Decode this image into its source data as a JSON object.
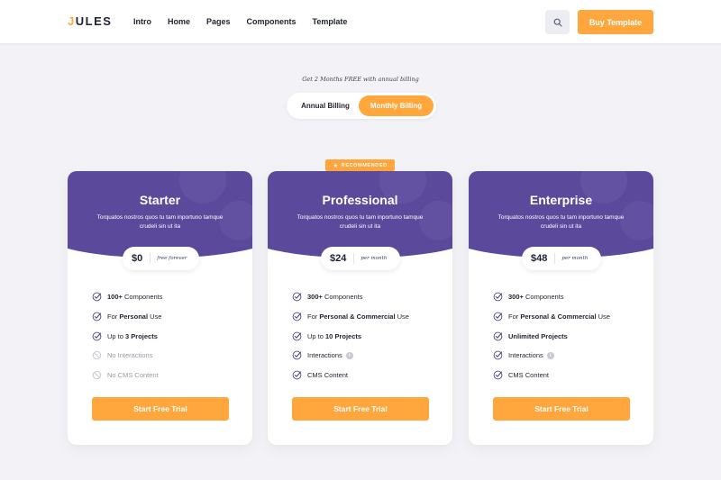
{
  "header": {
    "logo_prefix": "J",
    "logo_rest": "ULES",
    "nav": [
      "Intro",
      "Home",
      "Pages",
      "Components",
      "Template"
    ],
    "search_icon": "search-icon",
    "buy_label": "Buy Template"
  },
  "billing": {
    "promo": "Get 2 Months FREE with annual billing",
    "options": [
      "Annual Billing",
      "Monthly Billing"
    ],
    "selected": "Monthly Billing"
  },
  "colors": {
    "accent": "#ffa63d",
    "header_purple": "#5b4a9b",
    "text": "#1f2231"
  },
  "recommended": "RECOMMENDED",
  "plans": [
    {
      "name": "Starter",
      "desc": "Torquatos nostros quos tu tam inportuno tamque crudeli sin ut ita",
      "price": "$0",
      "period": "free forever",
      "features": [
        {
          "pre": "",
          "bold": "100+",
          "post": " Components",
          "enabled": true,
          "info": false
        },
        {
          "pre": "For ",
          "bold": "Personal",
          "post": " Use",
          "enabled": true,
          "info": false
        },
        {
          "pre": "Up to ",
          "bold": "3 Projects",
          "post": "",
          "enabled": true,
          "info": false
        },
        {
          "pre": "No Interactions",
          "bold": "",
          "post": "",
          "enabled": false,
          "info": false
        },
        {
          "pre": "No CMS Content",
          "bold": "",
          "post": "",
          "enabled": false,
          "info": false
        }
      ],
      "cta": "Start Free Trial"
    },
    {
      "name": "Professional",
      "desc": "Torquatos nostros quos tu tam inportuno tamque crudeli sin ut ita",
      "price": "$24",
      "period": "per month",
      "features": [
        {
          "pre": "",
          "bold": "300+",
          "post": " Components",
          "enabled": true,
          "info": false
        },
        {
          "pre": "For ",
          "bold": "Personal & Commercial",
          "post": " Use",
          "enabled": true,
          "info": false
        },
        {
          "pre": "Up to ",
          "bold": "10 Projects",
          "post": "",
          "enabled": true,
          "info": false
        },
        {
          "pre": "Interactions",
          "bold": "",
          "post": "",
          "enabled": true,
          "info": true
        },
        {
          "pre": "CMS Content",
          "bold": "",
          "post": "",
          "enabled": true,
          "info": false
        }
      ],
      "cta": "Start Free Trial"
    },
    {
      "name": "Enterprise",
      "desc": "Torquatos nostros quos tu tam inportuno tamque crudeli sin ut ita",
      "price": "$48",
      "period": "per month",
      "features": [
        {
          "pre": "",
          "bold": "300+",
          "post": " Components",
          "enabled": true,
          "info": false
        },
        {
          "pre": "For ",
          "bold": "Personal & Commercial",
          "post": " Use",
          "enabled": true,
          "info": false
        },
        {
          "pre": "",
          "bold": "Unlimited Projects",
          "post": "",
          "enabled": true,
          "info": false
        },
        {
          "pre": "Interactions",
          "bold": "",
          "post": "",
          "enabled": true,
          "info": true
        },
        {
          "pre": "CMS Content",
          "bold": "",
          "post": "",
          "enabled": true,
          "info": false
        }
      ],
      "cta": "Start Free Trial"
    }
  ]
}
